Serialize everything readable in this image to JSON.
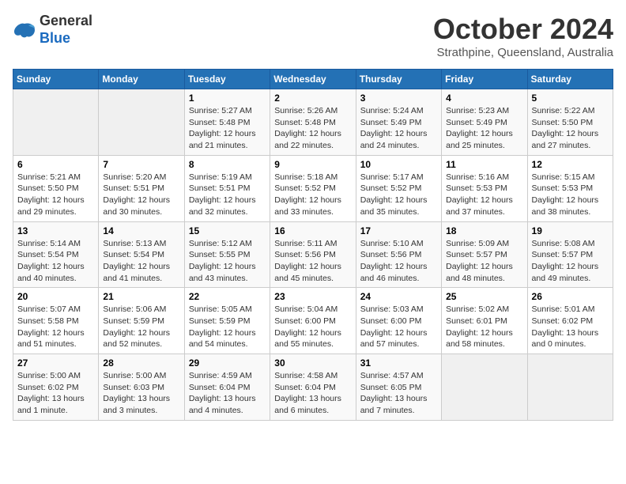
{
  "header": {
    "logo": {
      "general": "General",
      "blue": "Blue"
    },
    "title": "October 2024",
    "location": "Strathpine, Queensland, Australia"
  },
  "calendar": {
    "weekdays": [
      "Sunday",
      "Monday",
      "Tuesday",
      "Wednesday",
      "Thursday",
      "Friday",
      "Saturday"
    ],
    "weeks": [
      [
        {
          "day": null,
          "info": null
        },
        {
          "day": null,
          "info": null
        },
        {
          "day": "1",
          "info": "Sunrise: 5:27 AM\nSunset: 5:48 PM\nDaylight: 12 hours and 21 minutes."
        },
        {
          "day": "2",
          "info": "Sunrise: 5:26 AM\nSunset: 5:48 PM\nDaylight: 12 hours and 22 minutes."
        },
        {
          "day": "3",
          "info": "Sunrise: 5:24 AM\nSunset: 5:49 PM\nDaylight: 12 hours and 24 minutes."
        },
        {
          "day": "4",
          "info": "Sunrise: 5:23 AM\nSunset: 5:49 PM\nDaylight: 12 hours and 25 minutes."
        },
        {
          "day": "5",
          "info": "Sunrise: 5:22 AM\nSunset: 5:50 PM\nDaylight: 12 hours and 27 minutes."
        }
      ],
      [
        {
          "day": "6",
          "info": "Sunrise: 5:21 AM\nSunset: 5:50 PM\nDaylight: 12 hours and 29 minutes."
        },
        {
          "day": "7",
          "info": "Sunrise: 5:20 AM\nSunset: 5:51 PM\nDaylight: 12 hours and 30 minutes."
        },
        {
          "day": "8",
          "info": "Sunrise: 5:19 AM\nSunset: 5:51 PM\nDaylight: 12 hours and 32 minutes."
        },
        {
          "day": "9",
          "info": "Sunrise: 5:18 AM\nSunset: 5:52 PM\nDaylight: 12 hours and 33 minutes."
        },
        {
          "day": "10",
          "info": "Sunrise: 5:17 AM\nSunset: 5:52 PM\nDaylight: 12 hours and 35 minutes."
        },
        {
          "day": "11",
          "info": "Sunrise: 5:16 AM\nSunset: 5:53 PM\nDaylight: 12 hours and 37 minutes."
        },
        {
          "day": "12",
          "info": "Sunrise: 5:15 AM\nSunset: 5:53 PM\nDaylight: 12 hours and 38 minutes."
        }
      ],
      [
        {
          "day": "13",
          "info": "Sunrise: 5:14 AM\nSunset: 5:54 PM\nDaylight: 12 hours and 40 minutes."
        },
        {
          "day": "14",
          "info": "Sunrise: 5:13 AM\nSunset: 5:54 PM\nDaylight: 12 hours and 41 minutes."
        },
        {
          "day": "15",
          "info": "Sunrise: 5:12 AM\nSunset: 5:55 PM\nDaylight: 12 hours and 43 minutes."
        },
        {
          "day": "16",
          "info": "Sunrise: 5:11 AM\nSunset: 5:56 PM\nDaylight: 12 hours and 45 minutes."
        },
        {
          "day": "17",
          "info": "Sunrise: 5:10 AM\nSunset: 5:56 PM\nDaylight: 12 hours and 46 minutes."
        },
        {
          "day": "18",
          "info": "Sunrise: 5:09 AM\nSunset: 5:57 PM\nDaylight: 12 hours and 48 minutes."
        },
        {
          "day": "19",
          "info": "Sunrise: 5:08 AM\nSunset: 5:57 PM\nDaylight: 12 hours and 49 minutes."
        }
      ],
      [
        {
          "day": "20",
          "info": "Sunrise: 5:07 AM\nSunset: 5:58 PM\nDaylight: 12 hours and 51 minutes."
        },
        {
          "day": "21",
          "info": "Sunrise: 5:06 AM\nSunset: 5:59 PM\nDaylight: 12 hours and 52 minutes."
        },
        {
          "day": "22",
          "info": "Sunrise: 5:05 AM\nSunset: 5:59 PM\nDaylight: 12 hours and 54 minutes."
        },
        {
          "day": "23",
          "info": "Sunrise: 5:04 AM\nSunset: 6:00 PM\nDaylight: 12 hours and 55 minutes."
        },
        {
          "day": "24",
          "info": "Sunrise: 5:03 AM\nSunset: 6:00 PM\nDaylight: 12 hours and 57 minutes."
        },
        {
          "day": "25",
          "info": "Sunrise: 5:02 AM\nSunset: 6:01 PM\nDaylight: 12 hours and 58 minutes."
        },
        {
          "day": "26",
          "info": "Sunrise: 5:01 AM\nSunset: 6:02 PM\nDaylight: 13 hours and 0 minutes."
        }
      ],
      [
        {
          "day": "27",
          "info": "Sunrise: 5:00 AM\nSunset: 6:02 PM\nDaylight: 13 hours and 1 minute."
        },
        {
          "day": "28",
          "info": "Sunrise: 5:00 AM\nSunset: 6:03 PM\nDaylight: 13 hours and 3 minutes."
        },
        {
          "day": "29",
          "info": "Sunrise: 4:59 AM\nSunset: 6:04 PM\nDaylight: 13 hours and 4 minutes."
        },
        {
          "day": "30",
          "info": "Sunrise: 4:58 AM\nSunset: 6:04 PM\nDaylight: 13 hours and 6 minutes."
        },
        {
          "day": "31",
          "info": "Sunrise: 4:57 AM\nSunset: 6:05 PM\nDaylight: 13 hours and 7 minutes."
        },
        {
          "day": null,
          "info": null
        },
        {
          "day": null,
          "info": null
        }
      ]
    ]
  }
}
